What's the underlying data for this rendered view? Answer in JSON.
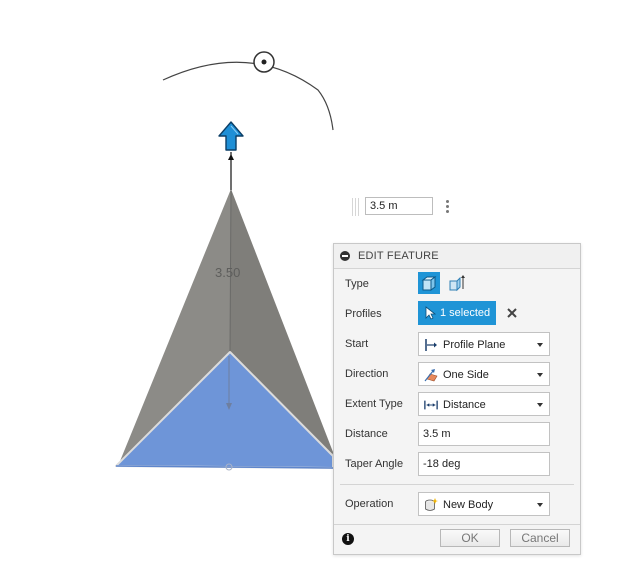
{
  "viewport": {
    "dimension_label": "3.50",
    "float_input_value": "3.5 m"
  },
  "dialog": {
    "title": "EDIT FEATURE",
    "type": {
      "label": "Type",
      "options": [
        "solid-extrude-icon",
        "surface-extrude-icon"
      ],
      "selected": 0
    },
    "profiles": {
      "label": "Profiles",
      "value": "1 selected"
    },
    "start": {
      "label": "Start",
      "value": "Profile Plane"
    },
    "direction": {
      "label": "Direction",
      "value": "One Side"
    },
    "extent_type": {
      "label": "Extent Type",
      "value": "Distance"
    },
    "distance": {
      "label": "Distance",
      "value": "3.5 m"
    },
    "taper_angle": {
      "label": "Taper Angle",
      "value": "-18 deg"
    },
    "operation": {
      "label": "Operation",
      "value": "New Body"
    },
    "ok_label": "OK",
    "cancel_label": "Cancel"
  },
  "colors": {
    "accent": "#1f94d6",
    "body_gray": "#8a8a88",
    "profile_blue": "#6e95d8"
  }
}
